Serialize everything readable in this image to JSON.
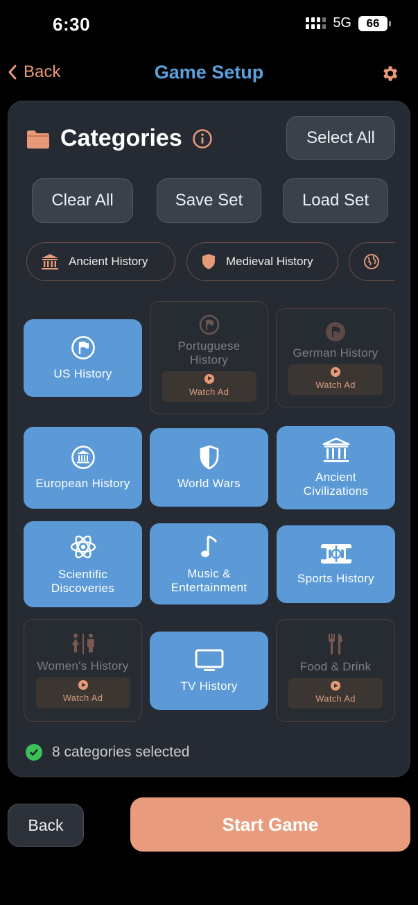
{
  "status": {
    "time": "6:30",
    "network": "5G",
    "battery": "66"
  },
  "nav": {
    "back_label": "Back",
    "title": "Game Setup"
  },
  "header": {
    "title": "Categories",
    "select_all": "Select All"
  },
  "actions": {
    "clear_all": "Clear All",
    "save_set": "Save Set",
    "load_set": "Load Set"
  },
  "chips": [
    {
      "label": "Ancient History",
      "icon": "museum-icon"
    },
    {
      "label": "Medieval History",
      "icon": "shield-icon"
    },
    {
      "label": "",
      "icon": "globe-icon"
    }
  ],
  "categories": [
    {
      "label": "US History",
      "icon": "flag-icon",
      "selected": true
    },
    {
      "label": "Portuguese History",
      "icon": "flag-icon",
      "selected": false,
      "locked": true
    },
    {
      "label": "German History",
      "icon": "flag-icon",
      "selected": false,
      "locked": true
    },
    {
      "label": "European History",
      "icon": "museum-icon",
      "selected": true
    },
    {
      "label": "World Wars",
      "icon": "shield-icon",
      "selected": true
    },
    {
      "label": "Ancient Civilizations",
      "icon": "museum-icon",
      "selected": true
    },
    {
      "label": "Scientific Discoveries",
      "icon": "atom-icon",
      "selected": true
    },
    {
      "label": "Music & Entertainment",
      "icon": "music-note-icon",
      "selected": true
    },
    {
      "label": "Sports History",
      "icon": "stadium-icon",
      "selected": true
    },
    {
      "label": "Women's History",
      "icon": "people-icon",
      "selected": false,
      "locked": true
    },
    {
      "label": "TV History",
      "icon": "tv-icon",
      "selected": true
    },
    {
      "label": "Food & Drink",
      "icon": "fork-knife-icon",
      "selected": false,
      "locked": true
    }
  ],
  "watch_ad": "Watch Ad",
  "selection": {
    "text": "8 categories selected"
  },
  "footer": {
    "back_label": "Back",
    "start_label": "Start Game"
  },
  "colors": {
    "accent": "#e99c7d",
    "selected_tile": "#5b9ad6",
    "title_blue": "#5aa0e0",
    "panel": "#262b33"
  }
}
